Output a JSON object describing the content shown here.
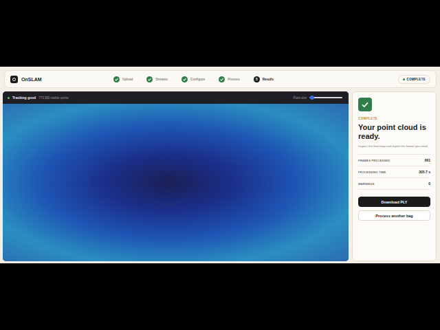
{
  "app": {
    "name": "OnSLAM"
  },
  "steps": [
    {
      "label": "Upload",
      "state": "done"
    },
    {
      "label": "Streams",
      "state": "done"
    },
    {
      "label": "Configure",
      "state": "done"
    },
    {
      "label": "Process",
      "state": "done"
    },
    {
      "label": "Results",
      "state": "current",
      "number": "5"
    }
  ],
  "status_badge": "COMPLETE",
  "viewer": {
    "tracking": "Tracking good",
    "points": "773,950 visible points",
    "point_size": {
      "label": "Point size",
      "level": 0.08
    }
  },
  "result": {
    "eyebrow": "COMPLETE",
    "title": "Your point cloud is ready.",
    "description": "Inspect the final map and export the format you need.",
    "stats": [
      {
        "label": "FRAMES PROCESSED",
        "value": "661"
      },
      {
        "label": "PROCESSING TIME",
        "value": "305.7 s"
      },
      {
        "label": "WARNINGS",
        "value": "0"
      }
    ],
    "buttons": [
      {
        "label": "Download PLY",
        "kind": "primary"
      },
      {
        "label": "Process another bag",
        "kind": "secondary"
      }
    ]
  }
}
